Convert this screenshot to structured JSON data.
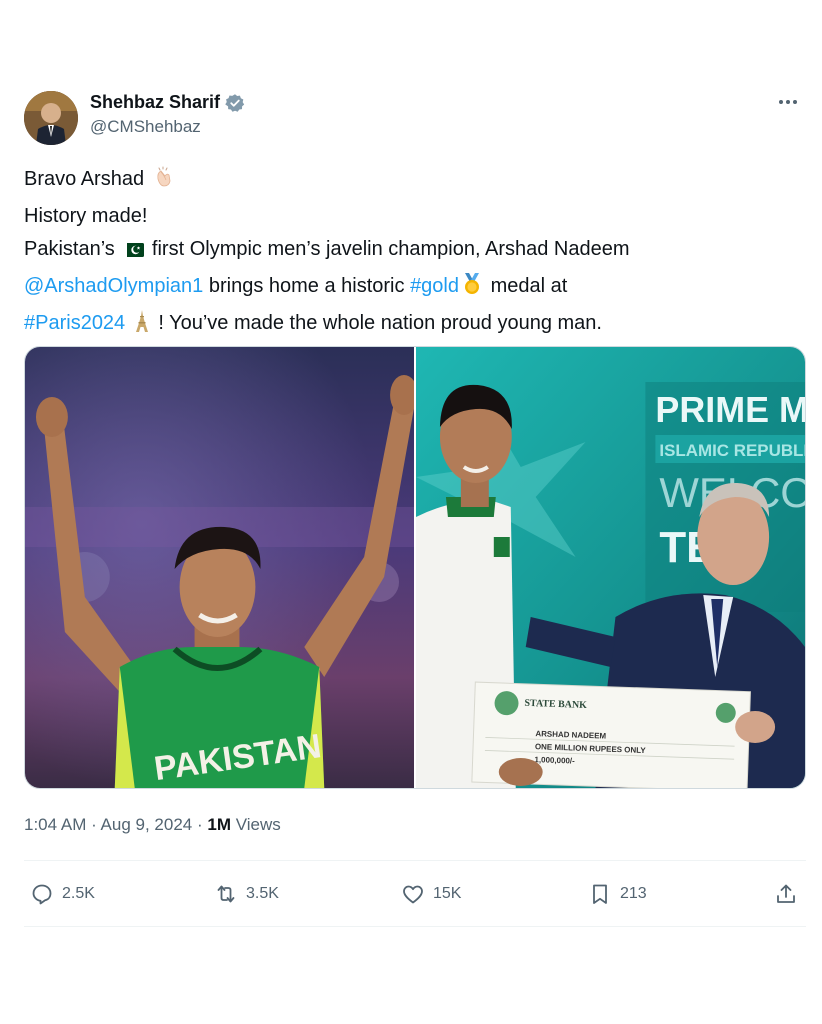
{
  "author": {
    "display_name": "Shehbaz Sharif",
    "handle": "@CMShehbaz",
    "verified": true
  },
  "tweet": {
    "line1_text": "Bravo Arshad",
    "line2_text": "History made!",
    "line3_prefix": "Pakistan’s",
    "line3_suffix": "first Olympic men’s javelin champion, Arshad Nadeem",
    "mention": "@ArshadOlympian1",
    "line4_middle": "brings home a historic",
    "hashtag_gold": "#gold",
    "line4_suffix": "medal at",
    "hashtag_paris": "#Paris2024",
    "line5_suffix": "! You’ve made the whole nation proud young man."
  },
  "media": {
    "photo1": {
      "jersey_text": "PAKISTAN"
    },
    "photo2": {
      "banner_line1": "PRIME MI",
      "banner_line2": "ISLAMIC REPUBLIC",
      "banner_line3": "WELCO",
      "banner_line4": "TEA",
      "cheque_bank": "STATE BANK",
      "cheque_payto": "ARSHAD NADEEM",
      "cheque_rupees": "ONE MILLION RUPEES ONLY",
      "cheque_amount": "1,000,000/-"
    }
  },
  "meta": {
    "time": "1:04 AM",
    "separator1": " · ",
    "date": "Aug 9, 2024",
    "separator2": " · ",
    "views_count": "1M",
    "views_label": " Views"
  },
  "actions": {
    "replies": "2.5K",
    "reposts": "3.5K",
    "likes": "15K",
    "bookmarks": "213"
  },
  "colors": {
    "link": "#1d9bf0",
    "text": "#0f1419",
    "secondary": "#536471",
    "verified": "#829aab"
  }
}
